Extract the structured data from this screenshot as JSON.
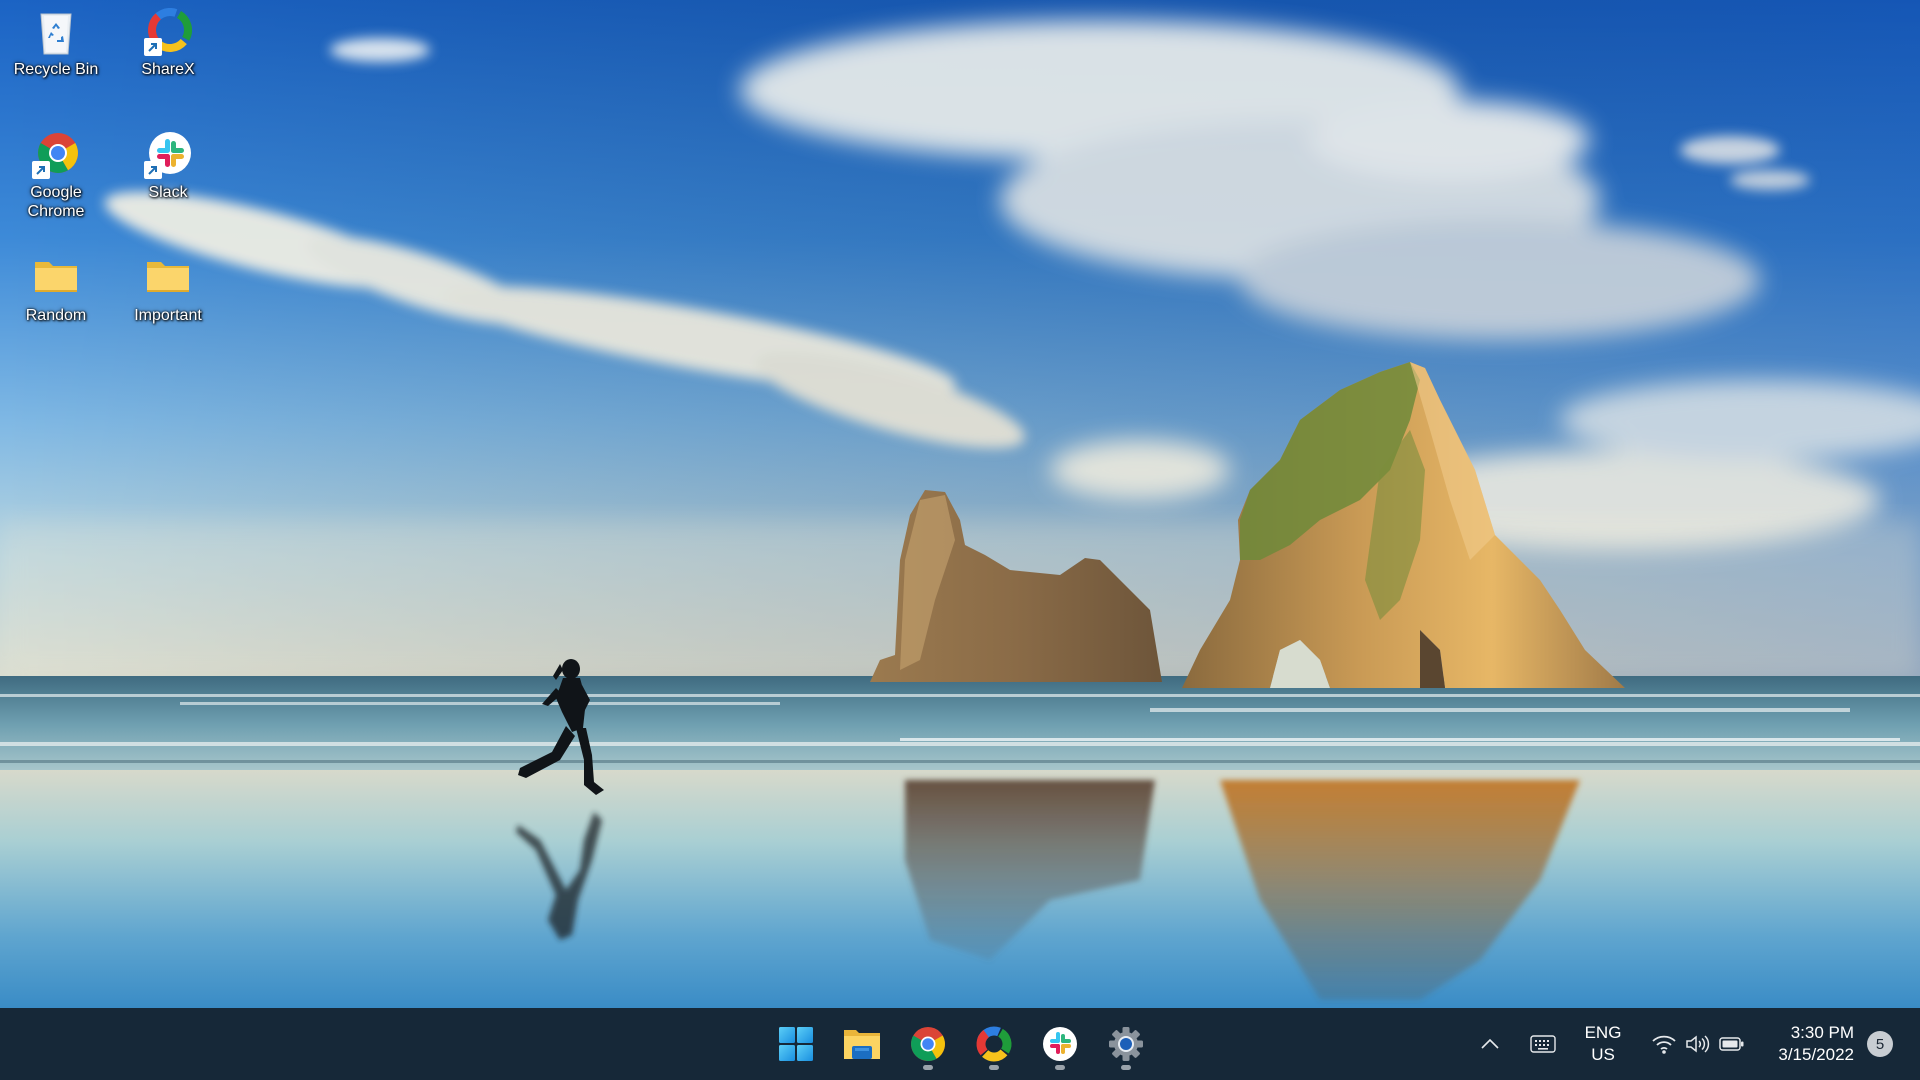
{
  "desktop": {
    "wallpaper": "beach-with-sea-arch-rocks-and-runner",
    "icons": [
      {
        "label": "Recycle Bin",
        "icon": "recycle-bin-icon",
        "shortcut": false
      },
      {
        "label": "ShareX",
        "icon": "sharex-icon",
        "shortcut": true
      },
      {
        "label": "Google Chrome",
        "icon": "chrome-icon",
        "shortcut": true
      },
      {
        "label": "Slack",
        "icon": "slack-icon",
        "shortcut": true
      },
      {
        "label": "Random",
        "icon": "folder-icon",
        "shortcut": false
      },
      {
        "label": "Important",
        "icon": "folder-icon",
        "shortcut": false
      }
    ]
  },
  "taskbar": {
    "apps": [
      {
        "name": "Start",
        "icon": "windows-start-icon",
        "running": false
      },
      {
        "name": "File Explorer",
        "icon": "file-explorer-icon",
        "running": false
      },
      {
        "name": "Google Chrome",
        "icon": "chrome-icon",
        "running": true
      },
      {
        "name": "ShareX",
        "icon": "sharex-icon",
        "running": true
      },
      {
        "name": "Slack",
        "icon": "slack-icon",
        "running": true
      },
      {
        "name": "Settings",
        "icon": "settings-gear-icon",
        "running": true
      }
    ],
    "tray": {
      "overflow_icon": "chevron-up-icon",
      "keyboard_icon": "touch-keyboard-icon",
      "language_line1": "ENG",
      "language_line2": "US",
      "wifi_icon": "wifi-icon",
      "volume_icon": "speaker-icon",
      "battery_icon": "battery-icon",
      "time": "3:30 PM",
      "date": "3/15/2022",
      "notification_count": "5"
    },
    "colors": {
      "background": "#162838",
      "indicator": "#9aa3ab"
    }
  }
}
